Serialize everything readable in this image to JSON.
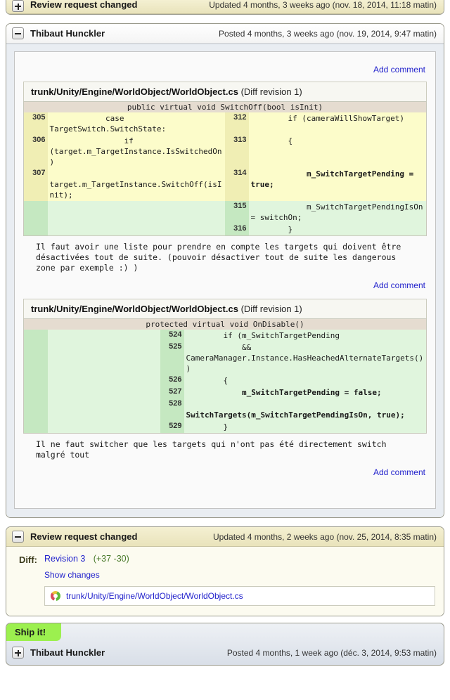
{
  "entries": [
    {
      "type": "review-request-changed-top",
      "expander": "plus",
      "title": "Review request changed",
      "meta": "Updated 4 months, 3 weeks ago (nov. 18, 2014, 11:18 matin)"
    },
    {
      "type": "review",
      "expander": "minus",
      "title": "Thibaut Hunckler",
      "meta": "Posted 4 months, 3 weeks ago (nov. 19, 2014, 9:47 matin)"
    }
  ],
  "review": {
    "add_comment_top": "Add comment",
    "add_comment_label": "Add comment",
    "fragments": [
      {
        "filename": "trunk/Unity/Engine/WorldObject/WorldObject.cs",
        "revision": "(Diff revision 1)",
        "section_header": "public virtual void SwitchOff(bool isInit)",
        "two_column": true,
        "rows": [
          {
            "kind": "equal",
            "left_ln": "305",
            "left_code": "            case TargetSwitch.SwitchState:",
            "right_ln": "312",
            "right_code": "        if (cameraWillShowTarget)"
          },
          {
            "kind": "equal",
            "left_ln": "306",
            "left_code": "                if (target.m_TargetInstance.IsSwitchedOn)",
            "right_ln": "313",
            "right_code": "        {"
          },
          {
            "kind": "equal",
            "left_ln": "307",
            "left_code": "                    target.m_TargetInstance.SwitchOff(isInit);",
            "right_ln": "314",
            "right_code": "            m_SwitchTargetPending = true;",
            "right_bold": true
          },
          {
            "kind": "insert",
            "left_ln": "",
            "left_code": "",
            "right_ln": "315",
            "right_code": "            m_SwitchTargetPendingIsOn = switchOn;"
          },
          {
            "kind": "insert",
            "left_ln": "",
            "left_code": "",
            "right_ln": "316",
            "right_code": "        }"
          }
        ],
        "comment_text": "Il faut avoir une liste pour prendre en compte les targets qui doivent être désactivées tout de suite. (pouvoir désactiver tout de suite les dangerous zone par exemple :) )",
        "add_comment_label": "Add comment"
      },
      {
        "filename": "trunk/Unity/Engine/WorldObject/WorldObject.cs",
        "revision": "(Diff revision 1)",
        "section_header": "protected virtual void OnDisable()",
        "two_column": true,
        "rows": [
          {
            "kind": "insert",
            "left_ln": "",
            "left_code": "",
            "right_ln": "524",
            "right_code": "        if (m_SwitchTargetPending"
          },
          {
            "kind": "insert",
            "left_ln": "",
            "left_code": "",
            "right_ln": "525",
            "right_code": "            && CameraManager.Instance.HasHeachedAlternateTargets())"
          },
          {
            "kind": "insert",
            "left_ln": "",
            "left_code": "",
            "right_ln": "526",
            "right_code": "        {"
          },
          {
            "kind": "insert",
            "left_ln": "",
            "left_code": "",
            "right_ln": "527",
            "right_code": "            m_SwitchTargetPending = false;",
            "right_bold": true
          },
          {
            "kind": "insert",
            "left_ln": "",
            "left_code": "",
            "right_ln": "528",
            "right_code": "            SwitchTargets(m_SwitchTargetPendingIsOn, true);",
            "right_bold": true
          },
          {
            "kind": "insert",
            "left_ln": "",
            "left_code": "",
            "right_ln": "529",
            "right_code": "        }"
          }
        ],
        "comment_text": "Il ne faut switcher que les targets qui n'ont pas été directement switch malgré tout",
        "add_comment_label": "Add comment"
      }
    ]
  },
  "changed_entry": {
    "expander": "minus",
    "title": "Review request changed",
    "meta": "Updated 4 months, 2 weeks ago (nov. 25, 2014, 8:35 matin)",
    "diff_label": "Diff:",
    "revision_link": "Revision 3",
    "revision_stats": "(+37 -30)",
    "show_changes": "Show changes",
    "files": [
      {
        "icon": "file-modified-icon",
        "name": "trunk/Unity/Engine/WorldObject/WorldObject.cs"
      }
    ]
  },
  "shipit_entry": {
    "badge": "Ship it!",
    "expander": "plus",
    "title": "Thibaut Hunckler",
    "meta": "Posted 4 months, 1 week ago (déc. 3, 2014, 9:53 matin)"
  },
  "colors": {
    "cream_header": "#efeacb",
    "insert_line": "#e0f5dd",
    "insert_gutter": "#c5e8c1",
    "equal_line": "#fcfcca",
    "equal_gutter": "#f0eeb4",
    "section_header": "#e5dcd0",
    "link": "#2222cc",
    "shipit_green": "#9cf04f",
    "stat_green": "#4a7a2a"
  }
}
